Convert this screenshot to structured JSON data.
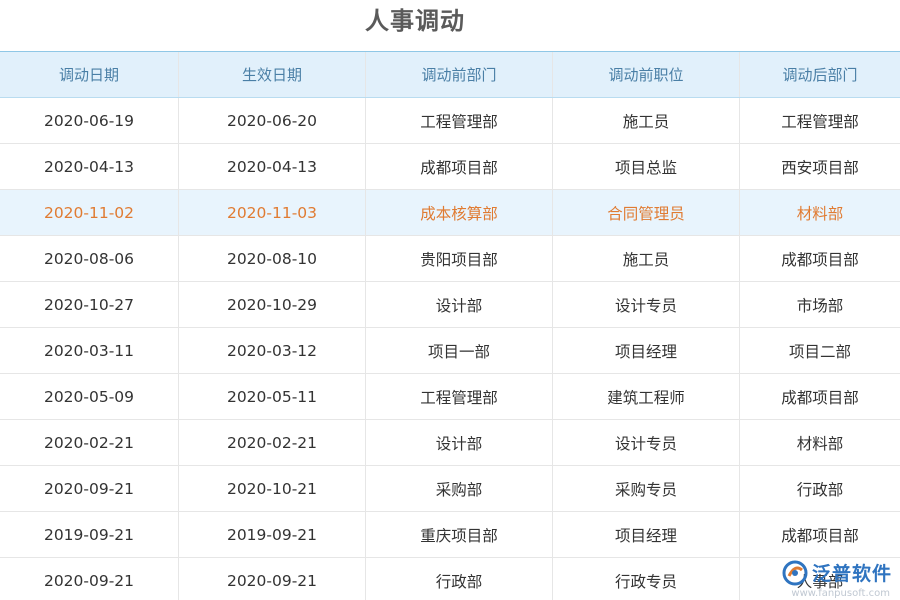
{
  "title": "人事调动",
  "columns": [
    "调动日期",
    "生效日期",
    "调动前部门",
    "调动前职位",
    "调动后部门"
  ],
  "rows": [
    [
      "2020-06-19",
      "2020-06-20",
      "工程管理部",
      "施工员",
      "工程管理部"
    ],
    [
      "2020-04-13",
      "2020-04-13",
      "成都项目部",
      "项目总监",
      "西安项目部"
    ],
    [
      "2020-11-02",
      "2020-11-03",
      "成本核算部",
      "合同管理员",
      "材料部"
    ],
    [
      "2020-08-06",
      "2020-08-10",
      "贵阳项目部",
      "施工员",
      "成都项目部"
    ],
    [
      "2020-10-27",
      "2020-10-29",
      "设计部",
      "设计专员",
      "市场部"
    ],
    [
      "2020-03-11",
      "2020-03-12",
      "项目一部",
      "项目经理",
      "项目二部"
    ],
    [
      "2020-05-09",
      "2020-05-11",
      "工程管理部",
      "建筑工程师",
      "成都项目部"
    ],
    [
      "2020-02-21",
      "2020-02-21",
      "设计部",
      "设计专员",
      "材料部"
    ],
    [
      "2020-09-21",
      "2020-10-21",
      "采购部",
      "采购专员",
      "行政部"
    ],
    [
      "2019-09-21",
      "2019-09-21",
      "重庆项目部",
      "项目经理",
      "成都项目部"
    ],
    [
      "2020-09-21",
      "2020-09-21",
      "行政部",
      "行政专员",
      "人事部"
    ]
  ],
  "highlighted_row_index": 2,
  "colors": {
    "title": "#5a5a5a",
    "header_bg": "#e1f0fb",
    "header_text": "#4a7fa6",
    "highlight_bg": "#e8f4fd",
    "highlight_text": "#e07b32",
    "logo": "#2f74c0"
  },
  "watermark": {
    "brand": "泛普软件",
    "url": "www.fanpusoft.com",
    "icon": "fanpu-logo-icon"
  }
}
